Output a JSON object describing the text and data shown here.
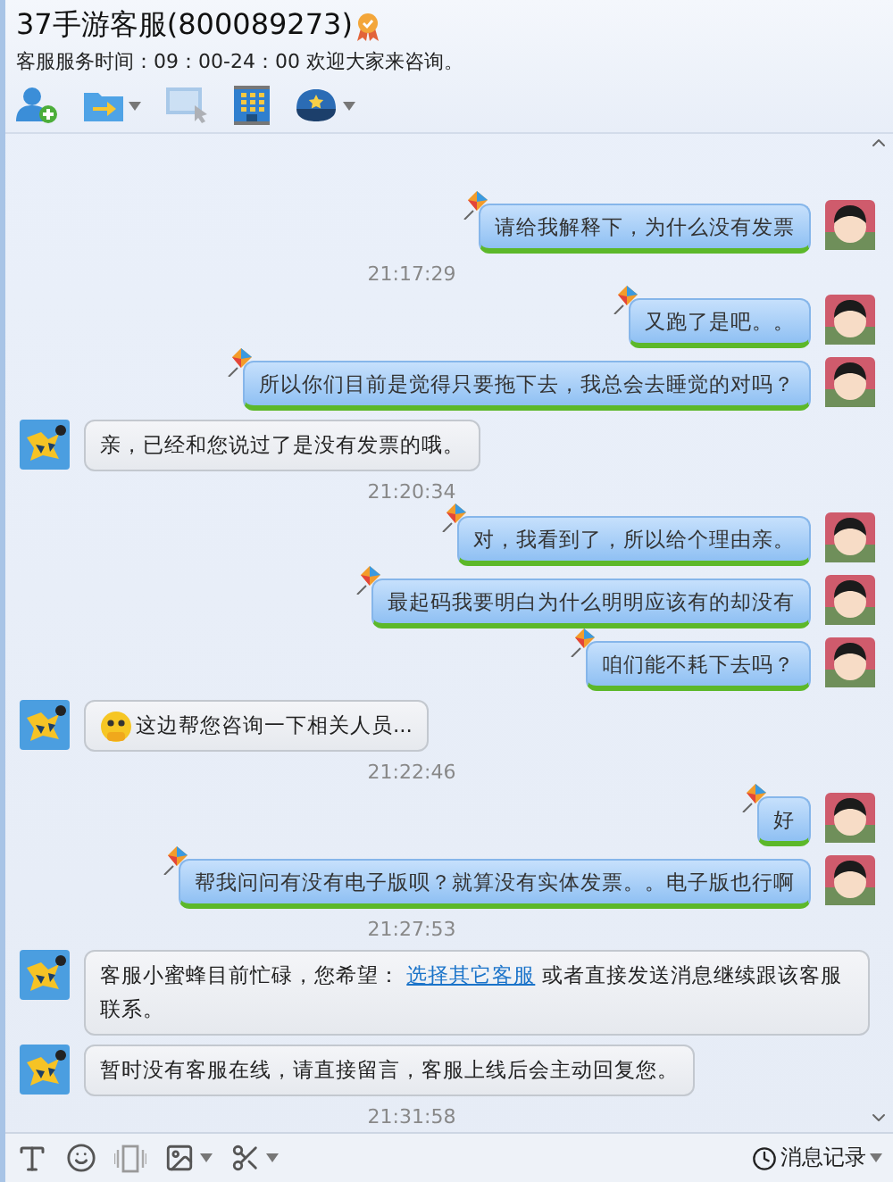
{
  "header": {
    "title": "37手游客服(800089273)",
    "subtitle": "客服服务时间：09：00-24：00 欢迎大家来咨询。"
  },
  "toolbar": [
    {
      "kind": "add-user",
      "caret": false,
      "disabled": false
    },
    {
      "kind": "folder",
      "caret": true,
      "disabled": false
    },
    {
      "kind": "screen",
      "caret": false,
      "disabled": true
    },
    {
      "kind": "building",
      "caret": false,
      "disabled": false
    },
    {
      "kind": "cap",
      "caret": true,
      "disabled": false
    }
  ],
  "messages": [
    {
      "kind": "out",
      "text": "请给我解释下，为什么没有发票"
    },
    {
      "kind": "time",
      "text": "21:17:29"
    },
    {
      "kind": "out",
      "text": "又跑了是吧。。"
    },
    {
      "kind": "out",
      "text": "所以你们目前是觉得只要拖下去，我总会去睡觉的对吗？"
    },
    {
      "kind": "in",
      "emoticon": false,
      "segments": [
        {
          "kind": "text",
          "text": "亲，已经和您说过了是没有发票的哦。"
        }
      ]
    },
    {
      "kind": "time",
      "text": "21:20:34"
    },
    {
      "kind": "out",
      "text": "对，我看到了，所以给个理由亲。"
    },
    {
      "kind": "out",
      "text": "最起码我要明白为什么明明应该有的却没有"
    },
    {
      "kind": "out",
      "text": "咱们能不耗下去吗？"
    },
    {
      "kind": "in",
      "emoticon": true,
      "segments": [
        {
          "kind": "text",
          "text": "这边帮您咨询一下相关人员..."
        }
      ]
    },
    {
      "kind": "time",
      "text": "21:22:46"
    },
    {
      "kind": "out",
      "text": "好"
    },
    {
      "kind": "out",
      "text": "帮我问问有没有电子版呗？就算没有实体发票。。电子版也行啊"
    },
    {
      "kind": "time",
      "text": "21:27:53"
    },
    {
      "kind": "in",
      "emoticon": false,
      "segments": [
        {
          "kind": "text",
          "text": "客服小蜜蜂目前忙碌，您希望： "
        },
        {
          "kind": "link",
          "text": "选择其它客服"
        },
        {
          "kind": "text",
          "text": " 或者直接发送消息继续跟该客服联系。"
        }
      ]
    },
    {
      "kind": "in",
      "emoticon": false,
      "segments": [
        {
          "kind": "text",
          "text": "暂时没有客服在线，请直接留言，客服上线后会主动回复您。"
        }
      ]
    },
    {
      "kind": "time",
      "text": "21:31:58"
    }
  ],
  "input_toolbar": {
    "tools": [
      {
        "kind": "font",
        "caret": false
      },
      {
        "kind": "emoji",
        "caret": false
      },
      {
        "kind": "shake",
        "caret": false
      },
      {
        "kind": "image",
        "caret": true
      },
      {
        "kind": "scissors",
        "caret": true
      }
    ],
    "history": "消息记录"
  }
}
